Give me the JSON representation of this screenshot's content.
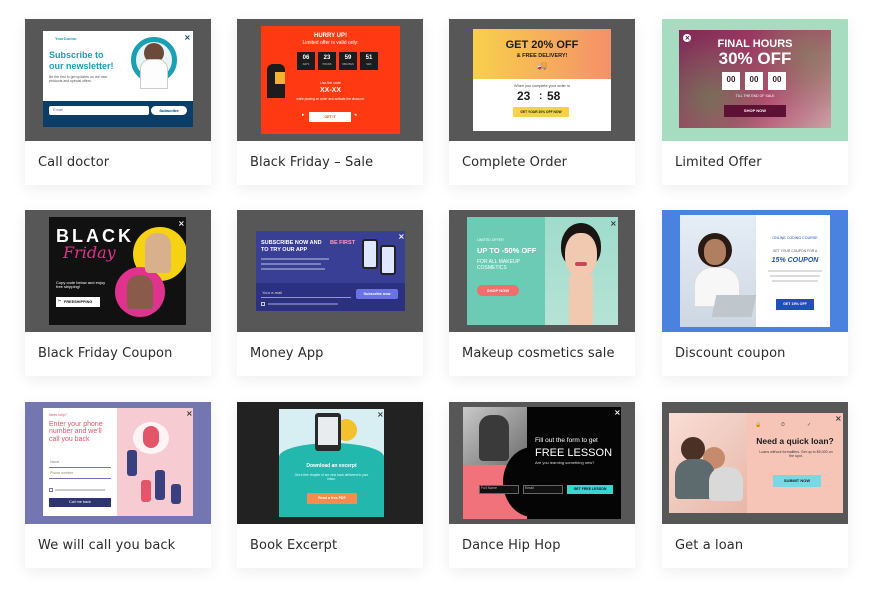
{
  "cards": [
    {
      "label": "Call doctor",
      "thumb": {
        "brand": "YourDoctor",
        "title_line1": "Subscribe to",
        "title_line2": "our newsletter!",
        "body": "Be the first to get updates on our new products and special offers.",
        "field": "Email",
        "button": "Subscribe"
      }
    },
    {
      "label": "Black Friday – Sale",
      "thumb": {
        "title": "HURRY UP!",
        "subtitle": "Limited offer is valid only:",
        "countdown": [
          "06",
          "23",
          "59",
          "51"
        ],
        "countdown_units": [
          "DAYS",
          "HOURS",
          "MINUTES",
          "SEC"
        ],
        "code_label": "Use the code",
        "code": "XX-XX",
        "note": "while placing an order and activate the discount.",
        "button": "GET IT"
      }
    },
    {
      "label": "Complete Order",
      "thumb": {
        "headline": "GET 20% OFF",
        "subheadline": "& FREE DELIVERY!",
        "note": "When you complete your order in",
        "minutes": "23",
        "seconds": "58",
        "button": "GET YOUR 20% OFF NOW"
      }
    },
    {
      "label": "Limited Offer",
      "thumb": {
        "title": "FINAL HOURS",
        "offer": "30% OFF",
        "countdown": [
          "00",
          "00",
          "00"
        ],
        "note": "TILL THE END OF SALE",
        "button": "SHOP NOW"
      }
    },
    {
      "label": "Black Friday Coupon",
      "thumb": {
        "word1": "BLACK",
        "word2": "Friday",
        "note": "Copy code below and enjoy free shipping!",
        "code": "FREESHIPPING"
      }
    },
    {
      "label": "Money App",
      "thumb": {
        "title_white": "SUBSCRIBE NOW AND",
        "title_accent": "BE FIRST",
        "title_line2": "TO TRY OUR APP",
        "field": "Your e-mail",
        "button": "Subscribe now"
      }
    },
    {
      "label": "Makeup cosmetics sale",
      "thumb": {
        "kicker": "LIMITED OFFER",
        "headline": "UP TO -50% OFF",
        "sub": "FOR ALL MAKEUP COSMETICS",
        "button": "SHOP NOW"
      }
    },
    {
      "label": "Discount coupon",
      "thumb": {
        "kicker": "ONLINE CODING COURSE",
        "small": "GET YOUR COUPON FOR A",
        "headline": "15% COUPON",
        "button": "GET 15% OFF"
      }
    },
    {
      "label": "We will call you back",
      "thumb": {
        "kicker": "Need help?",
        "title": "Enter your phone number and we'll call you back",
        "field1": "Name",
        "field2": "Phone number",
        "button": "Call me back"
      }
    },
    {
      "label": "Book Excerpt",
      "thumb": {
        "title": "Download an excerpt",
        "body": "Get a free chapter of our new book delivered to your inbox.",
        "button": "Read a free PDF"
      }
    },
    {
      "label": "Dance Hip Hop",
      "thumb": {
        "line1": "Fill out the form to get",
        "line2": "FREE LESSON",
        "line3": "Are you learning something new?",
        "field1": "Full Name",
        "field2": "Email",
        "button": "GET FREE LESSON"
      }
    },
    {
      "label": "Get a loan",
      "thumb": {
        "title": "Need a quick loan?",
        "body": "Loans without formalities. Get up to $5,000 on the spot.",
        "button": "SUBMIT NOW"
      }
    }
  ],
  "colors": {
    "card_bg": "#ffffff",
    "call_doctor_accent": "#1b9fb3",
    "black_friday_red": "#ff3a12",
    "complete_order_gradient": [
      "#f9d04a",
      "#f4906a"
    ],
    "limited_offer_green": "#a6ddc0",
    "money_app_purple": "#3a3f96",
    "makeup_teal": "#6ccbb5",
    "discount_blue": "#4a82e0",
    "callback_purple": "#7376b0",
    "book_teal": "#22b8ae",
    "dance_pink": "#f2727b",
    "loan_pink": "#f6c5b8"
  }
}
